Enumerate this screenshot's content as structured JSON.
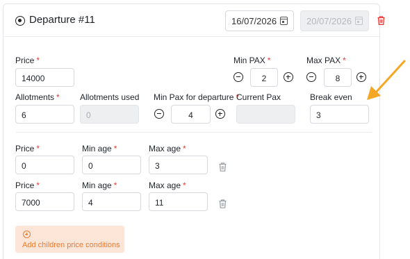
{
  "departure": {
    "title": "Departure #11",
    "start_date": "16/07/2026",
    "end_date": "20/07/2026"
  },
  "pricing": {
    "price_label": "Price",
    "price_value": "14000",
    "min_pax_label": "Min PAX",
    "min_pax_value": "2",
    "max_pax_label": "Max PAX",
    "max_pax_value": "8",
    "allotments_label": "Allotments",
    "allotments_value": "6",
    "allotments_used_label": "Allotments used",
    "allotments_used_value": "0",
    "min_pax_departure_label": "Min Pax for departure",
    "min_pax_departure_value": "4",
    "current_pax_label": "Current Pax",
    "current_pax_value": "",
    "break_even_label": "Break even",
    "break_even_value": "3",
    "required_mark": "*"
  },
  "children_conditions": [
    {
      "price_label": "Price",
      "price": "0",
      "min_age_label": "Min age",
      "min_age": "0",
      "max_age_label": "Max age",
      "max_age": "3"
    },
    {
      "price_label": "Price",
      "price": "7000",
      "min_age_label": "Min age",
      "min_age": "4",
      "max_age_label": "Max age",
      "max_age": "11"
    }
  ],
  "add_children_label": "Add children price conditions",
  "icons": {
    "radio": "radio-selected-icon",
    "calendar": "calendar-icon",
    "trash": "trash-icon",
    "minus": "minus-circle-icon",
    "plus": "plus-circle-icon",
    "annotation_arrow": "arrow-icon"
  },
  "colors": {
    "required": "#e53935",
    "delete": "#e53935",
    "accent": "#ee7a2f",
    "accent_bg": "#fde6d8",
    "arrow": "#f5a623"
  }
}
